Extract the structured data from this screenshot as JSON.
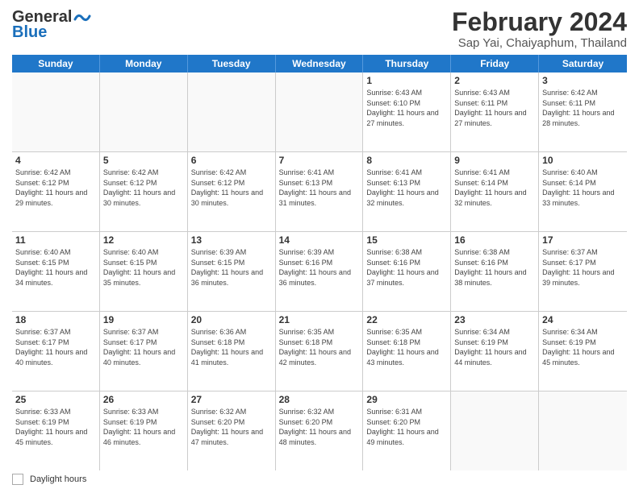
{
  "header": {
    "logo_line1": "General",
    "logo_line2": "Blue",
    "main_title": "February 2024",
    "sub_title": "Sap Yai, Chaiyaphum, Thailand"
  },
  "calendar": {
    "days_of_week": [
      "Sunday",
      "Monday",
      "Tuesday",
      "Wednesday",
      "Thursday",
      "Friday",
      "Saturday"
    ],
    "weeks": [
      [
        {
          "day": "",
          "info": "",
          "empty": true
        },
        {
          "day": "",
          "info": "",
          "empty": true
        },
        {
          "day": "",
          "info": "",
          "empty": true
        },
        {
          "day": "",
          "info": "",
          "empty": true
        },
        {
          "day": "1",
          "info": "Sunrise: 6:43 AM\nSunset: 6:10 PM\nDaylight: 11 hours\nand 27 minutes."
        },
        {
          "day": "2",
          "info": "Sunrise: 6:43 AM\nSunset: 6:11 PM\nDaylight: 11 hours\nand 27 minutes."
        },
        {
          "day": "3",
          "info": "Sunrise: 6:42 AM\nSunset: 6:11 PM\nDaylight: 11 hours\nand 28 minutes."
        }
      ],
      [
        {
          "day": "4",
          "info": "Sunrise: 6:42 AM\nSunset: 6:12 PM\nDaylight: 11 hours\nand 29 minutes."
        },
        {
          "day": "5",
          "info": "Sunrise: 6:42 AM\nSunset: 6:12 PM\nDaylight: 11 hours\nand 30 minutes."
        },
        {
          "day": "6",
          "info": "Sunrise: 6:42 AM\nSunset: 6:12 PM\nDaylight: 11 hours\nand 30 minutes."
        },
        {
          "day": "7",
          "info": "Sunrise: 6:41 AM\nSunset: 6:13 PM\nDaylight: 11 hours\nand 31 minutes."
        },
        {
          "day": "8",
          "info": "Sunrise: 6:41 AM\nSunset: 6:13 PM\nDaylight: 11 hours\nand 32 minutes."
        },
        {
          "day": "9",
          "info": "Sunrise: 6:41 AM\nSunset: 6:14 PM\nDaylight: 11 hours\nand 32 minutes."
        },
        {
          "day": "10",
          "info": "Sunrise: 6:40 AM\nSunset: 6:14 PM\nDaylight: 11 hours\nand 33 minutes."
        }
      ],
      [
        {
          "day": "11",
          "info": "Sunrise: 6:40 AM\nSunset: 6:15 PM\nDaylight: 11 hours\nand 34 minutes."
        },
        {
          "day": "12",
          "info": "Sunrise: 6:40 AM\nSunset: 6:15 PM\nDaylight: 11 hours\nand 35 minutes."
        },
        {
          "day": "13",
          "info": "Sunrise: 6:39 AM\nSunset: 6:15 PM\nDaylight: 11 hours\nand 36 minutes."
        },
        {
          "day": "14",
          "info": "Sunrise: 6:39 AM\nSunset: 6:16 PM\nDaylight: 11 hours\nand 36 minutes."
        },
        {
          "day": "15",
          "info": "Sunrise: 6:38 AM\nSunset: 6:16 PM\nDaylight: 11 hours\nand 37 minutes."
        },
        {
          "day": "16",
          "info": "Sunrise: 6:38 AM\nSunset: 6:16 PM\nDaylight: 11 hours\nand 38 minutes."
        },
        {
          "day": "17",
          "info": "Sunrise: 6:37 AM\nSunset: 6:17 PM\nDaylight: 11 hours\nand 39 minutes."
        }
      ],
      [
        {
          "day": "18",
          "info": "Sunrise: 6:37 AM\nSunset: 6:17 PM\nDaylight: 11 hours\nand 40 minutes."
        },
        {
          "day": "19",
          "info": "Sunrise: 6:37 AM\nSunset: 6:17 PM\nDaylight: 11 hours\nand 40 minutes."
        },
        {
          "day": "20",
          "info": "Sunrise: 6:36 AM\nSunset: 6:18 PM\nDaylight: 11 hours\nand 41 minutes."
        },
        {
          "day": "21",
          "info": "Sunrise: 6:35 AM\nSunset: 6:18 PM\nDaylight: 11 hours\nand 42 minutes."
        },
        {
          "day": "22",
          "info": "Sunrise: 6:35 AM\nSunset: 6:18 PM\nDaylight: 11 hours\nand 43 minutes."
        },
        {
          "day": "23",
          "info": "Sunrise: 6:34 AM\nSunset: 6:19 PM\nDaylight: 11 hours\nand 44 minutes."
        },
        {
          "day": "24",
          "info": "Sunrise: 6:34 AM\nSunset: 6:19 PM\nDaylight: 11 hours\nand 45 minutes."
        }
      ],
      [
        {
          "day": "25",
          "info": "Sunrise: 6:33 AM\nSunset: 6:19 PM\nDaylight: 11 hours\nand 45 minutes."
        },
        {
          "day": "26",
          "info": "Sunrise: 6:33 AM\nSunset: 6:19 PM\nDaylight: 11 hours\nand 46 minutes."
        },
        {
          "day": "27",
          "info": "Sunrise: 6:32 AM\nSunset: 6:20 PM\nDaylight: 11 hours\nand 47 minutes."
        },
        {
          "day": "28",
          "info": "Sunrise: 6:32 AM\nSunset: 6:20 PM\nDaylight: 11 hours\nand 48 minutes."
        },
        {
          "day": "29",
          "info": "Sunrise: 6:31 AM\nSunset: 6:20 PM\nDaylight: 11 hours\nand 49 minutes."
        },
        {
          "day": "",
          "info": "",
          "empty": true
        },
        {
          "day": "",
          "info": "",
          "empty": true
        }
      ]
    ]
  },
  "footer": {
    "label": "Daylight hours"
  }
}
